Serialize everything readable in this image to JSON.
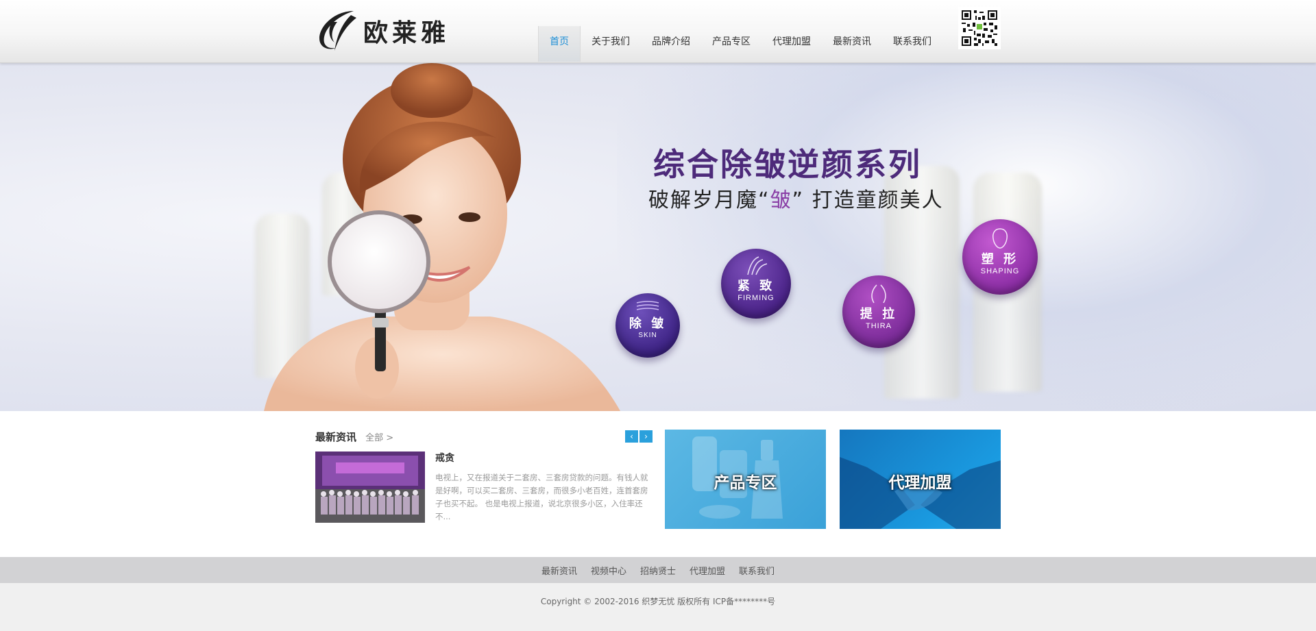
{
  "header": {
    "logo_text": "欧莱雅",
    "nav": [
      {
        "label": "首页",
        "active": true
      },
      {
        "label": "关于我们",
        "active": false
      },
      {
        "label": "品牌介绍",
        "active": false
      },
      {
        "label": "产品专区",
        "active": false
      },
      {
        "label": "代理加盟",
        "active": false
      },
      {
        "label": "最新资讯",
        "active": false
      },
      {
        "label": "联系我们",
        "active": false
      }
    ],
    "qr_icon": "qr-code-icon"
  },
  "banner": {
    "headline": "综合除皱逆颜系列",
    "subline_before": "破解岁月魔“",
    "subline_accent": "皱",
    "subline_after": "” 打造童颜美人",
    "badges": [
      {
        "cn": "除 皱",
        "en": "SKIN",
        "icon": "wrinkle-lines-icon"
      },
      {
        "cn": "紧 致",
        "en": "FIRMING",
        "icon": "firming-icon"
      },
      {
        "cn": "提 拉",
        "en": "THIRA",
        "icon": "lift-icon"
      },
      {
        "cn": "塑 形",
        "en": "SHAPING",
        "icon": "face-outline-icon"
      }
    ],
    "slide_count": 3,
    "active_slide": 3,
    "colors": {
      "headline": "#4d2a7a",
      "badge": "#5a2a8e",
      "dot_active": "#1e8fd6"
    }
  },
  "news": {
    "title": "最新资讯",
    "all_link": "全部 >",
    "prev_icon": "chevron-left-icon",
    "next_icon": "chevron-right-icon",
    "item": {
      "title": "戒贪",
      "description": "电视上，又在报道关于二套房、三套房贷款的问题。有钱人就是好啊，可以买二套房、三套房，而很多小老百姓，连首套房子也买不起。 也是电视上报道，说北京很多小区，入住率还不..."
    }
  },
  "tiles": [
    {
      "label": "产品专区"
    },
    {
      "label": "代理加盟"
    }
  ],
  "footer": {
    "links": [
      "最新资讯",
      "视频中心",
      "招纳贤士",
      "代理加盟",
      "联系我们"
    ],
    "copyright": "Copyright © 2002-2016 织梦无忧 版权所有 ICP备********号"
  }
}
